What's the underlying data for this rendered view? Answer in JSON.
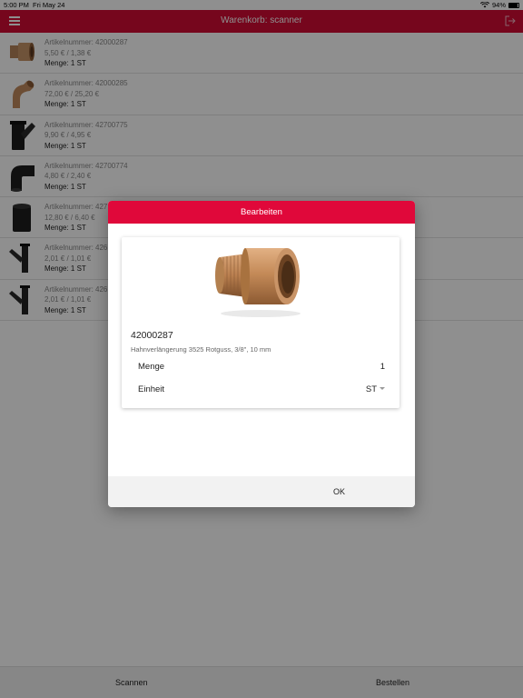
{
  "status": {
    "time": "5:00 PM",
    "date": "Fri May 24",
    "battery": "94%"
  },
  "header": {
    "title": "Warenkorb: scanner"
  },
  "cart": {
    "items": [
      {
        "art": "Artikelnummer: 42000287",
        "price": "5,50 € / 1,38 €",
        "qty": "Menge: 1 ST",
        "icon": "bronze-adapter"
      },
      {
        "art": "Artikelnummer: 42000285",
        "price": "72,00 € / 25,20 €",
        "qty": "Menge: 1 ST",
        "icon": "bronze-elbow"
      },
      {
        "art": "Artikelnummer: 42700775",
        "price": "9,90 € / 4,95 €",
        "qty": "Menge: 1 ST",
        "icon": "black-y-branch"
      },
      {
        "art": "Artikelnummer: 42700774",
        "price": "4,80 € / 2,40 €",
        "qty": "Menge: 1 ST",
        "icon": "black-elbow"
      },
      {
        "art": "Artikelnummer: 427",
        "price": "12,80 € / 6,40 €",
        "qty": "Menge: 1 ST",
        "icon": "black-pipe"
      },
      {
        "art": "Artikelnummer: 426",
        "price": "2,01 € / 1,01 €",
        "qty": "Menge: 1 ST",
        "icon": "black-y-branch"
      },
      {
        "art": "Artikelnummer: 426",
        "price": "2,01 € / 1,01 €",
        "qty": "Menge: 1 ST",
        "icon": "black-y-branch"
      }
    ]
  },
  "bottom": {
    "scan": "Scannen",
    "order": "Bestellen"
  },
  "dialog": {
    "title": "Bearbeiten",
    "code": "42000287",
    "description": "Hahnverlängerung 3525 Rotguss, 3/8\", 10 mm",
    "menge_label": "Menge",
    "menge_value": "1",
    "einheit_label": "Einheit",
    "einheit_value": "ST",
    "ok": "OK"
  },
  "colors": {
    "accent": "#d20c35",
    "dialog_header": "#e0083a"
  }
}
